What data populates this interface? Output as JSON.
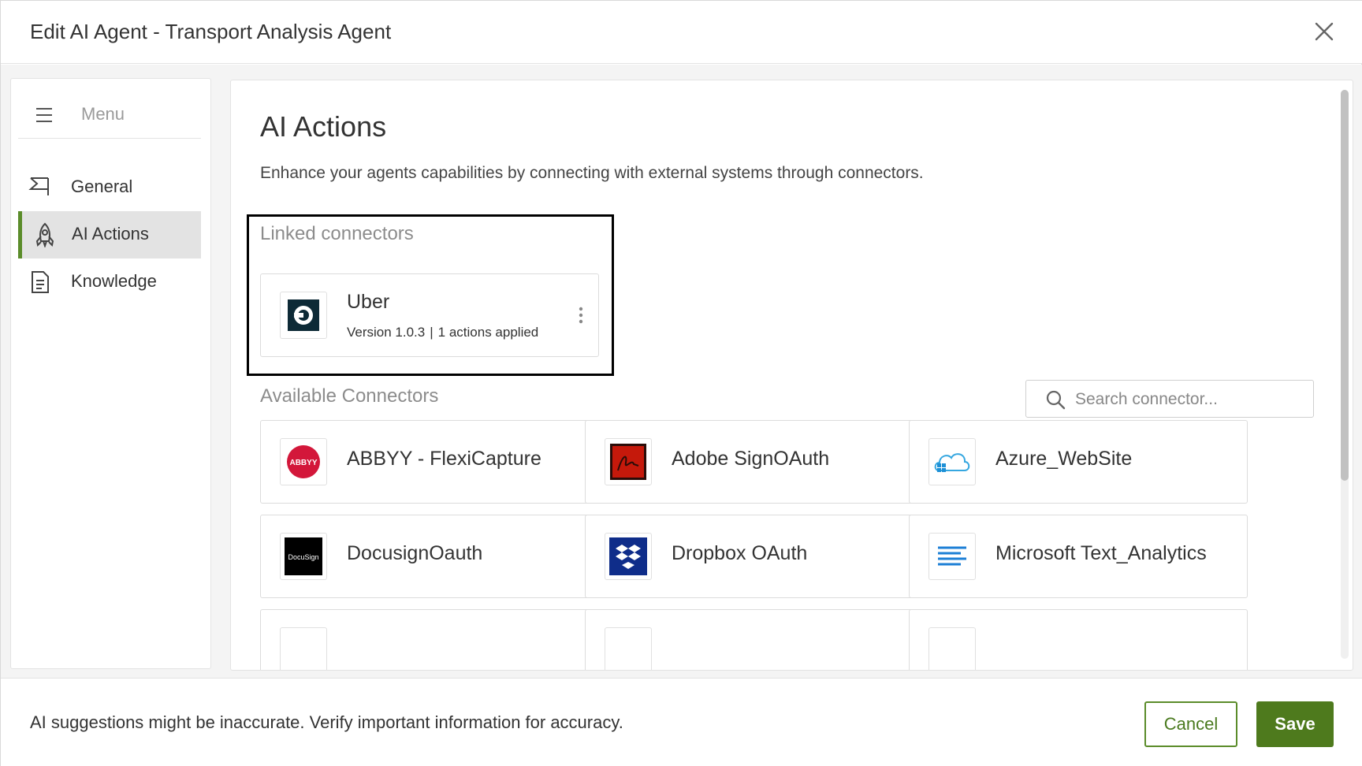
{
  "window": {
    "title": "Edit AI Agent - Transport Analysis Agent",
    "close_icon": "close-icon"
  },
  "sidebar": {
    "menu_label": "Menu",
    "items": [
      {
        "label": "General",
        "icon": "flag-icon",
        "active": false
      },
      {
        "label": "AI Actions",
        "icon": "rocket-icon",
        "active": true
      },
      {
        "label": "Knowledge",
        "icon": "document-icon",
        "active": false
      }
    ]
  },
  "main": {
    "title": "AI Actions",
    "description": "Enhance your agents capabilities by connecting with external systems through connectors.",
    "linked": {
      "heading": "Linked connectors",
      "connectors": [
        {
          "name": "Uber",
          "version": "Version 1.0.3",
          "actions": "1 actions applied",
          "icon": "uber-logo-icon"
        }
      ]
    },
    "available": {
      "heading": "Available Connectors",
      "search_placeholder": "Search connector...",
      "connectors": [
        {
          "name": "ABBYY - FlexiCapture",
          "icon": "abbyy-logo-icon",
          "logo_text": "ABBYY"
        },
        {
          "name": "Adobe SignOAuth",
          "icon": "adobe-sign-logo-icon"
        },
        {
          "name": "Azure_WebSite",
          "icon": "azure-cloud-logo-icon"
        },
        {
          "name": "DocusignOauth",
          "icon": "docusign-logo-icon",
          "logo_text": "DocuSign"
        },
        {
          "name": "Dropbox OAuth",
          "icon": "dropbox-logo-icon"
        },
        {
          "name": "Microsoft Text_Analytics",
          "icon": "text-lines-logo-icon"
        }
      ]
    }
  },
  "footer": {
    "note": "AI suggestions might be inaccurate. Verify important information for accuracy.",
    "cancel_label": "Cancel",
    "save_label": "Save"
  },
  "colors": {
    "accent_green": "#4e7a1d",
    "active_bar": "#5b8c2a",
    "active_bg": "#e3e3e3"
  }
}
